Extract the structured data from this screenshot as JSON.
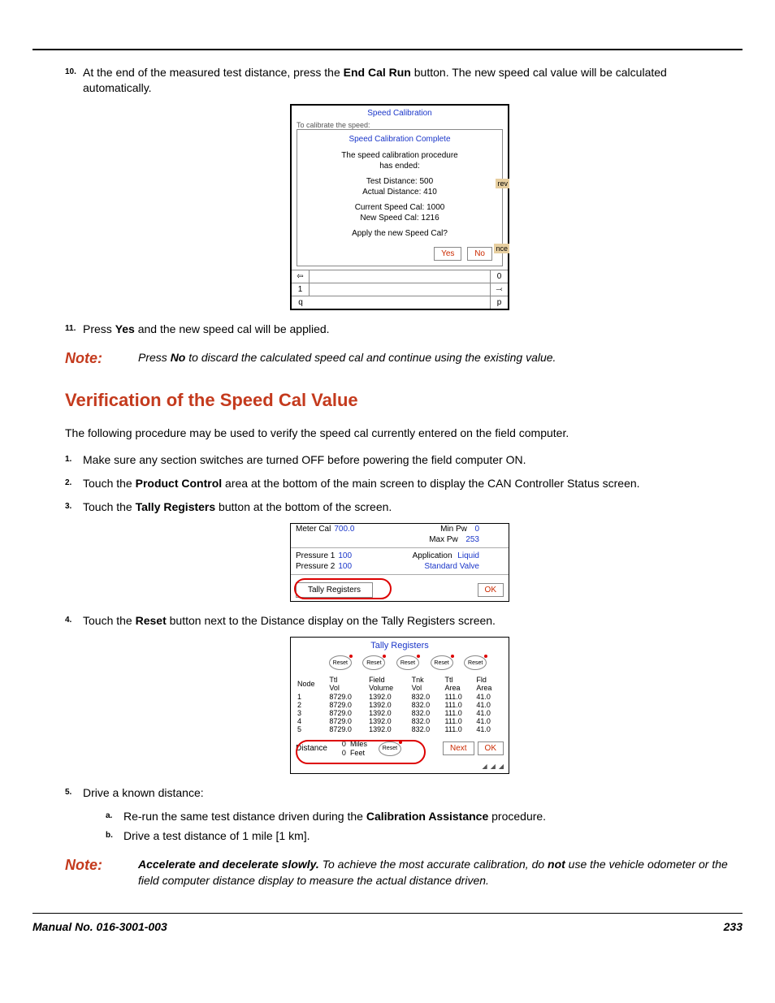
{
  "items": {
    "step10": {
      "num": "10.",
      "pre": "At the end of the measured test distance, press the ",
      "bold": "End Cal Run",
      "post": " button. The new speed cal value will be calculated automatically."
    },
    "step11": {
      "num": "11.",
      "pre": "Press ",
      "bold": "Yes",
      "post": " and the new speed cal will be applied."
    }
  },
  "note1": {
    "label": "Note:",
    "pre": "Press ",
    "bold": "No",
    "post": " to discard the calculated speed cal and continue using the existing value."
  },
  "section": {
    "title": "Verification of the Speed Cal Value",
    "intro": "The following procedure may be used to verify the speed cal currently entered on the field computer."
  },
  "verify": {
    "s1": {
      "num": "1.",
      "txt": "Make sure any section switches are turned OFF before powering the field computer ON."
    },
    "s2": {
      "num": "2.",
      "pre": "Touch the ",
      "bold": "Product Control",
      "post": " area at the bottom of the main screen to display the CAN Controller Status screen."
    },
    "s3": {
      "num": "3.",
      "pre": "Touch the ",
      "bold": "Tally Registers",
      "post": " button at the bottom of the screen."
    },
    "s4": {
      "num": "4.",
      "pre": "Touch the ",
      "bold": "Reset",
      "post": " button next to the Distance display on the Tally Registers screen."
    },
    "s5": {
      "num": "5.",
      "txt": "Drive a known distance:"
    },
    "s5a": {
      "num": "a.",
      "pre": "Re-run the same test distance driven during the ",
      "bold": "Calibration Assistance",
      "post": " procedure."
    },
    "s5b": {
      "num": "b.",
      "txt": "Drive a test distance of 1 mile [1 km]."
    }
  },
  "note2": {
    "label": "Note:",
    "boldLead": "Accelerate and decelerate slowly.",
    "mid": " To achieve the most accurate calibration, do ",
    "boldNot": "not",
    "post": " use the vehicle odometer or the field computer distance display to measure the actual distance driven."
  },
  "fig1": {
    "hdr": "Speed Calibration",
    "faint": "To calibrate the speed:",
    "dlgTitle": "Speed Calibration Complete",
    "l1": "The speed calibration procedure",
    "l2": "has ended:",
    "l3": "Test Distance:  500",
    "l4": "Actual Distance: 410",
    "l5": "Current Speed Cal: 1000",
    "l6": "New Speed Cal:  1216",
    "l7": "Apply the new Speed Cal?",
    "yes": "Yes",
    "no": "No",
    "side1": "rev",
    "side2": "nce",
    "bottom1": "1",
    "bottomq": "q",
    "bottom0": "0",
    "bottomp": "p"
  },
  "fig2": {
    "meter": "Meter Cal",
    "meterVal": "700.0",
    "minpw": "Min Pw",
    "minpwVal": "0",
    "maxpw": "Max Pw",
    "maxpwVal": "253",
    "p1": "Pressure 1",
    "p1v": "100",
    "p2": "Pressure 2",
    "p2v": "100",
    "app": "Application",
    "appVal": "Liquid",
    "std": "Standard Valve",
    "tally": "Tally Registers",
    "ok": "OK"
  },
  "fig3": {
    "hdr": "Tally Registers",
    "reset": "Reset",
    "headers": [
      "Node",
      "Ttl Vol",
      "Field Volume",
      "Tnk Vol",
      "Ttl Area",
      "Fld Area"
    ],
    "rows": [
      [
        "1",
        "8729.0",
        "1392.0",
        "832.0",
        "111.0",
        "41.0"
      ],
      [
        "2",
        "8729.0",
        "1392.0",
        "832.0",
        "111.0",
        "41.0"
      ],
      [
        "3",
        "8729.0",
        "1392.0",
        "832.0",
        "111.0",
        "41.0"
      ],
      [
        "4",
        "8729.0",
        "1392.0",
        "832.0",
        "111.0",
        "41.0"
      ],
      [
        "5",
        "8729.0",
        "1392.0",
        "832.0",
        "111.0",
        "41.0"
      ]
    ],
    "distance": "Distance",
    "dv1": "0",
    "du1": "Miles",
    "dv2": "0",
    "du2": "Feet",
    "next": "Next",
    "ok": "OK"
  },
  "footer": {
    "manual": "Manual No. 016-3001-003",
    "page": "233"
  }
}
